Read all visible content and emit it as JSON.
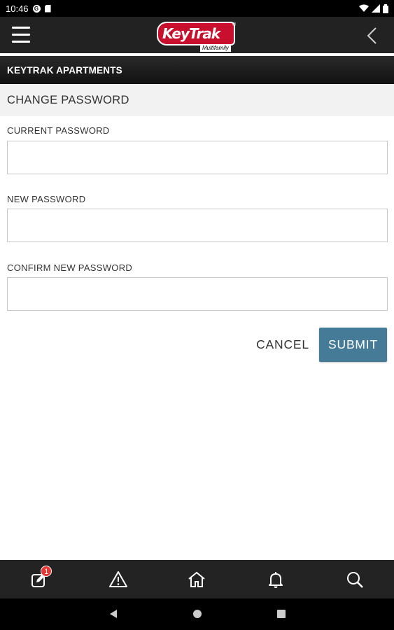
{
  "status_bar": {
    "time": "10:46",
    "icons": [
      "google-icon",
      "sd-card-icon",
      "wifi-icon",
      "signal-icon",
      "battery-icon"
    ]
  },
  "app_bar": {
    "logo_text": "KeyTrak",
    "logo_reg": "®",
    "logo_subtext": "Multifamily",
    "colors": {
      "background": "#222222",
      "logo_red": "#c8102e"
    }
  },
  "property": {
    "name": "KEYTRAK APARTMENTS"
  },
  "page": {
    "title": "CHANGE PASSWORD"
  },
  "form": {
    "current_password": {
      "label": "CURRENT PASSWORD",
      "value": "",
      "placeholder": ""
    },
    "new_password": {
      "label": "NEW PASSWORD",
      "value": "",
      "placeholder": ""
    },
    "confirm_password": {
      "label": "CONFIRM NEW PASSWORD",
      "value": "",
      "placeholder": ""
    },
    "cancel_label": "CANCEL",
    "submit_label": "SUBMIT",
    "submit_color": "#457b96"
  },
  "bottom_nav": {
    "items": [
      {
        "icon": "edit-note-icon",
        "badge": "1"
      },
      {
        "icon": "warning-icon"
      },
      {
        "icon": "home-icon"
      },
      {
        "icon": "bell-icon"
      },
      {
        "icon": "search-icon"
      }
    ]
  },
  "android_nav": {
    "icons": [
      "back-triangle-icon",
      "home-circle-icon",
      "recents-square-icon"
    ]
  }
}
